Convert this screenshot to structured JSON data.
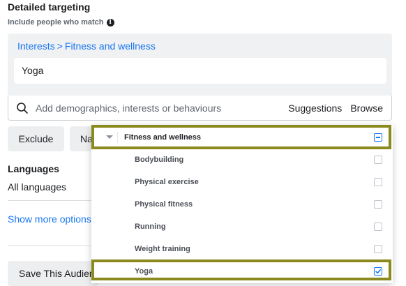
{
  "section": {
    "title": "Detailed targeting",
    "subtitle": "Include people who match"
  },
  "targeting": {
    "breadcrumb": {
      "parent": "Interests",
      "separator": ">",
      "child": "Fitness and wellness"
    },
    "selected_item": "Yoga"
  },
  "search": {
    "placeholder": "Add demographics, interests or behaviours",
    "suggestions_label": "Suggestions",
    "browse_label": "Browse"
  },
  "buttons": {
    "exclude": "Exclude",
    "narrow_partial": "Na",
    "save_partial": "Save This Audien"
  },
  "languages": {
    "label": "Languages",
    "value": "All languages"
  },
  "show_more": "Show more options",
  "dropdown": {
    "category": {
      "label": "Fitness and wellness",
      "state": "partial"
    },
    "items": [
      {
        "label": "Bodybuilding",
        "checked": false
      },
      {
        "label": "Physical exercise",
        "checked": false
      },
      {
        "label": "Physical fitness",
        "checked": false
      },
      {
        "label": "Running",
        "checked": false
      },
      {
        "label": "Weight training",
        "checked": false
      },
      {
        "label": "Yoga",
        "checked": true
      }
    ]
  },
  "colors": {
    "link": "#1877f2",
    "highlight": "#8b8a1e"
  }
}
